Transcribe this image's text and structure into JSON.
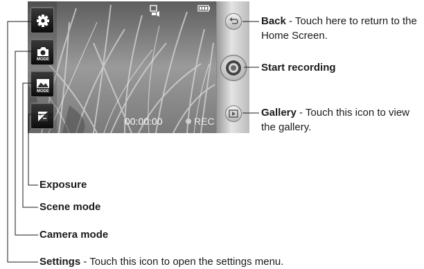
{
  "camera_ui": {
    "timer": "00:00:00",
    "rec_label": "REC"
  },
  "left_controls": [
    {
      "icon": "gear-icon",
      "overlay": ""
    },
    {
      "icon": "camera-mode-icon",
      "overlay": "MODE"
    },
    {
      "icon": "scene-mode-icon",
      "overlay": "MODE"
    },
    {
      "icon": "exposure-icon",
      "overlay": ""
    }
  ],
  "right_controls": [
    {
      "icon": "back-arrow-icon"
    },
    {
      "icon": "record-icon"
    },
    {
      "icon": "gallery-icon"
    }
  ],
  "callouts": {
    "back": {
      "title": "Back",
      "desc_line1": " - Touch here to return to the",
      "desc_line2": "Home Screen."
    },
    "start": {
      "title": "Start recording"
    },
    "gallery": {
      "title": "Gallery",
      "desc_line1": " - Touch this icon to view",
      "desc_line2": "the gallery."
    },
    "exposure": {
      "title": "Exposure"
    },
    "scene": {
      "title": "Scene mode"
    },
    "camera": {
      "title": "Camera mode"
    },
    "settings": {
      "title": "Settings",
      "desc": " - Touch this icon to open the settings menu."
    }
  },
  "colors": {
    "leader": "#c0202a",
    "panel_dark": "#111111"
  }
}
